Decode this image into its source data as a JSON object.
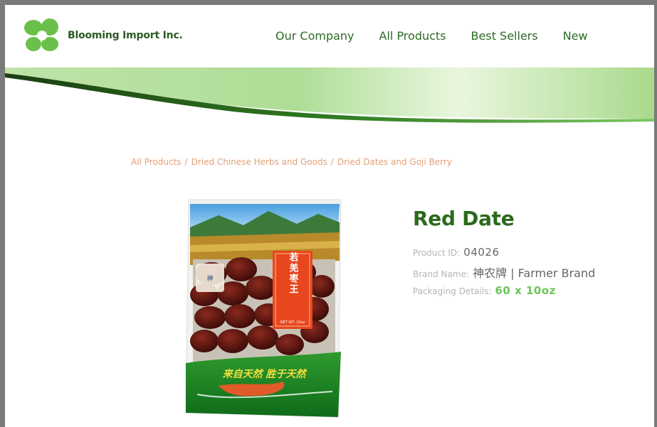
{
  "header": {
    "company_name": "Blooming Import Inc.",
    "nav": [
      "Our Company",
      "All Products",
      "Best Sellers",
      "New"
    ]
  },
  "breadcrumb": [
    "All Products",
    "Dried Chinese Herbs and Goods",
    "Dried Dates and Goji Berry"
  ],
  "product": {
    "title": "Red Date",
    "id_label": "Product ID:",
    "id_value": "04026",
    "brand_label": "Brand Name:",
    "brand_value": "神农牌 | Farmer Brand",
    "packaging_label": "Packaging Details:",
    "packaging_value": "60 x 10oz",
    "package_text_vertical": "若羌枣王",
    "package_net_wt": "NET WT: 10oz",
    "package_slogan": "来自天然 胜于天然"
  },
  "colors": {
    "brand_green": "#2b6a1c",
    "logo_green": "#6bc04b",
    "breadcrumb": "#e1a078",
    "accent_green": "#6dc45a"
  }
}
